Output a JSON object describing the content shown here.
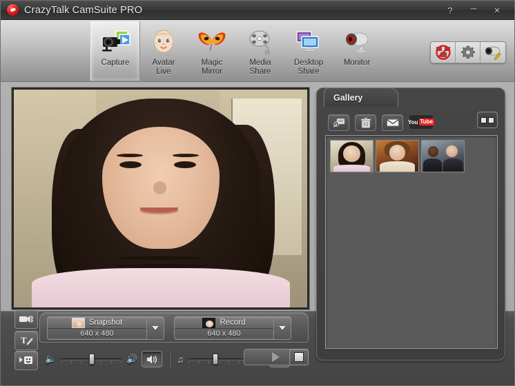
{
  "window": {
    "title": "CrazyTalk CamSuite PRO",
    "logo_icon": "crazytalk-logo-icon",
    "controls": {
      "help_label": "?",
      "minimize_label": "–",
      "close_label": "×"
    }
  },
  "toolbar": {
    "items": [
      {
        "label": "Capture",
        "icon": "camera-photo-icon",
        "selected": true
      },
      {
        "label": "Avatar\nLive",
        "icon": "baby-face-icon",
        "selected": false
      },
      {
        "label": "Magic\nMirror",
        "icon": "carnival-mask-icon",
        "selected": false
      },
      {
        "label": "Media\nShare",
        "icon": "film-reel-icon",
        "selected": false
      },
      {
        "label": "Desktop\nShare",
        "icon": "monitor-share-icon",
        "selected": false
      },
      {
        "label": "Monitor",
        "icon": "webcam-icon",
        "selected": false
      }
    ],
    "right_buttons": [
      {
        "name": "no-video-icon",
        "tooltip": "Disable Video"
      },
      {
        "name": "gear-icon",
        "tooltip": "Settings"
      },
      {
        "name": "webcam-setup-icon",
        "tooltip": "Webcam Setup"
      }
    ]
  },
  "preview": {
    "label": "webcam-live-preview"
  },
  "capture_bar": {
    "snapshot": {
      "label": "Snapshot",
      "resolution": "640 x 480",
      "icon": "snapshot-thumb-icon",
      "dropdown_icon": "chevron-down-icon"
    },
    "record": {
      "label": "Record",
      "resolution": "640 x 480",
      "icon": "record-thumb-icon",
      "dropdown_icon": "chevron-down-icon"
    }
  },
  "side_tools": [
    {
      "name": "video-effect-button",
      "icon": "camcorder-icon"
    },
    {
      "name": "text-paint-button",
      "icon": "text-brush-icon"
    },
    {
      "name": "emoticon-button",
      "icon": "emoticon-frame-icon"
    }
  ],
  "audio": {
    "speaker": {
      "low_icon": "speaker-low-icon",
      "high_icon": "speaker-high-icon",
      "toggle_icon": "speaker-toggle-icon",
      "value": 52
    },
    "microphone": {
      "music_icon": "music-note-icon",
      "mic_icon": "microphone-icon",
      "toggle_icon": "headset-toggle-icon",
      "value": 45
    }
  },
  "playback": {
    "play_icon": "play-arrow-icon",
    "stop_icon": "stop-square-icon"
  },
  "gallery": {
    "tab_label": "Gallery",
    "toolbar": [
      {
        "name": "open-folder-button",
        "icon": "open-image-icon"
      },
      {
        "name": "delete-button",
        "icon": "trash-icon"
      },
      {
        "name": "email-button",
        "icon": "envelope-icon"
      }
    ],
    "youtube": {
      "you": "You",
      "tube": "Tube"
    },
    "view_mode_icon": "two-pane-view-icon",
    "thumbnails": [
      {
        "name": "gallery-thumb-1",
        "alt": "portrait-woman-1"
      },
      {
        "name": "gallery-thumb-2",
        "alt": "portrait-woman-2"
      },
      {
        "name": "gallery-thumb-3",
        "alt": "portrait-two-men"
      }
    ]
  },
  "colors": {
    "titlebar": "#3a3a3a",
    "toolbar_top": "#dedede",
    "toolbar_bottom": "#8f8f8f",
    "panel_dark": "#444444",
    "gallery_bg": "#3e3e3e",
    "accent_red": "#e02020"
  }
}
